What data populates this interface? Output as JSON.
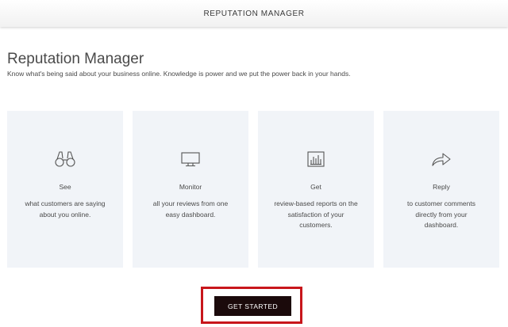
{
  "header": {
    "title": "REPUTATION MANAGER"
  },
  "main": {
    "title": "Reputation Manager",
    "subtitle": "Know what's being said about your business online. Knowledge is power and we put the power back in your hands.",
    "cards": [
      {
        "icon": "binoculars-icon",
        "title": "See",
        "text": "what customers are saying about you online."
      },
      {
        "icon": "monitor-icon",
        "title": "Monitor",
        "text": "all your reviews from one easy dashboard."
      },
      {
        "icon": "bar-chart-icon",
        "title": "Get",
        "text": "review-based reports on the satisfaction of your customers."
      },
      {
        "icon": "share-arrow-icon",
        "title": "Reply",
        "text": "to customer comments directly from your dashboard."
      }
    ],
    "cta_label": "GET STARTED"
  },
  "colors": {
    "card_bg": "#f1f4f8",
    "button_bg": "#1b0a0b",
    "highlight_border": "#c8161b"
  }
}
